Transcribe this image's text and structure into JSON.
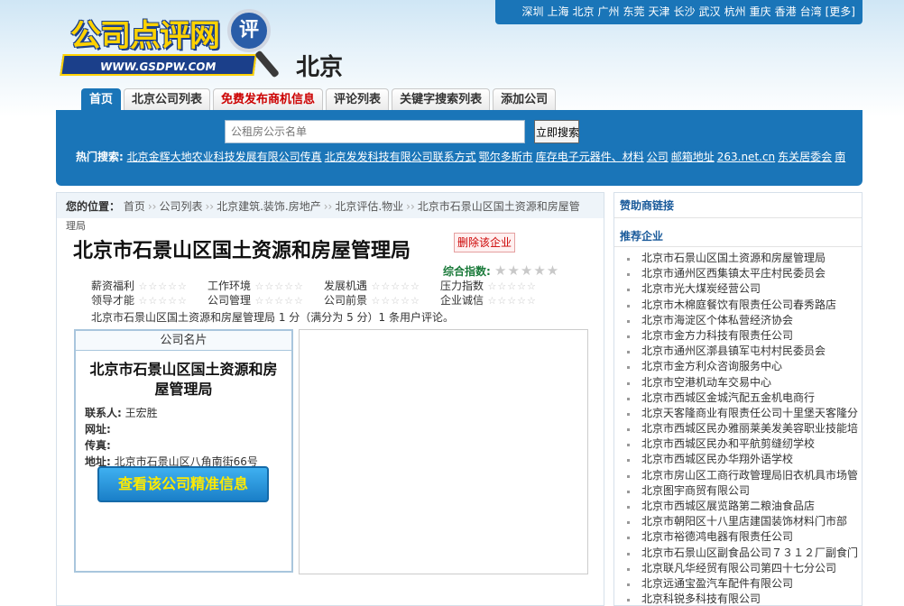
{
  "cities": [
    "深圳",
    "上海",
    "北京",
    "广州",
    "东莞",
    "天津",
    "长沙",
    "武汉",
    "杭州",
    "重庆",
    "香港",
    "台湾",
    "[更多]"
  ],
  "logo": {
    "text": "公司点评网",
    "url": "WWW.GSDPW.COM",
    "badge": "评"
  },
  "city_title": "北京",
  "tabs": [
    {
      "label": "首页",
      "active": true
    },
    {
      "label": "北京公司列表"
    },
    {
      "label": "免费发布商机信息",
      "red": true
    },
    {
      "label": "评论列表"
    },
    {
      "label": "关键字搜索列表"
    },
    {
      "label": "添加公司"
    }
  ],
  "search": {
    "placeholder": "公租房公示名单",
    "button": "立即搜索"
  },
  "hot": {
    "label": "热门搜索:",
    "links": [
      "北京金辉大地农业科技发展有限公司传真",
      "北京发发科技有限公司联系方式",
      "鄂尔多斯市",
      "库存电子元器件、材料",
      "公司",
      "邮箱地址",
      "263.net.cn",
      "东关居委会",
      "南"
    ]
  },
  "breadcrumb": {
    "label": "您的位置：",
    "items": [
      "首页",
      "公司列表",
      "北京建筑.装饰.房地产",
      "北京评估.物业",
      "北京市石景山区国土资源和房屋管"
    ],
    "overflow": "理局"
  },
  "company": {
    "title": "北京市石景山区国土资源和房屋管理局",
    "delete_label": "删除该企业",
    "overall_label": "综合指数:",
    "ratings_row1": [
      "薪资福利",
      "工作环境",
      "发展机遇",
      "压力指数"
    ],
    "ratings_row2": [
      "领导才能",
      "公司管理",
      "公司前景",
      "企业诚信"
    ],
    "summary": "北京市石景山区国土资源和房屋管理局 1 分（满分为 5 分）1 条用户评论。",
    "card_title": "公司名片",
    "card_name": "北京市石景山区国土资源和房屋管理局",
    "contact_label": "联系人:",
    "contact_value": "王宏胜",
    "web_label": "网址:",
    "fax_label": "传真:",
    "address_label": "地址:",
    "address_value": "北京市石景山区八角南街66号",
    "info_button": "查看该公司精准信息"
  },
  "sidebar": {
    "sponsor": "赞助商链接",
    "recommend": "推荐企业",
    "items": [
      "北京市石景山区国土资源和房屋管理局",
      "北京市通州区西集镇太平庄村民委员会",
      "北京市光大煤炭经营公司",
      "北京市木棉庭餐饮有限责任公司春秀路店",
      "北京市海淀区个体私营经济协会",
      "北京市金方力科技有限责任公司",
      "北京市通州区漷县镇军屯村村民委员会",
      "北京市金方利众咨询服务中心",
      "北京市空港机动车交易中心",
      "北京市西城区金城汽配五金机电商行",
      "北京天客隆商业有限责任公司十里堡天客隆分",
      "北京市西城区民办雅丽莱美发美容职业技能培",
      "北京市西城区民办和平航剪缝纫学校",
      "北京市西城区民办华翔外语学校",
      "北京市房山区工商行政管理局旧衣机具市场管",
      "北京图宇商贸有限公司",
      "北京市西城区展览路第二粮油食品店",
      "北京市朝阳区十八里店建国装饰材料门市部",
      "北京市裕德鸿电器有限责任公司",
      "北京市石景山区副食品公司７３１２厂副食门",
      "北京联凡华经贸有限公司第四十七分公司",
      "北京远通宝盈汽车配件有限公司",
      "北京科锐多科技有限公司"
    ]
  }
}
